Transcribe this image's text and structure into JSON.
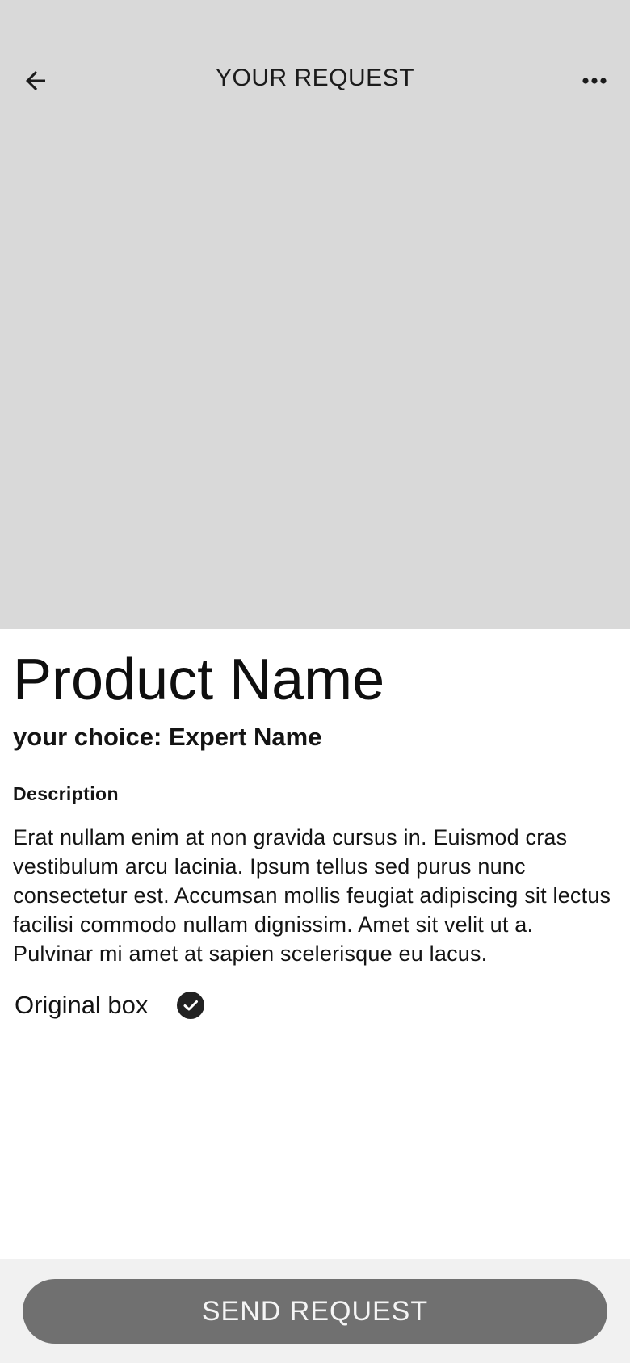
{
  "header": {
    "title": "YOUR REQUEST",
    "back_icon": "arrow-left-icon",
    "more_icon": "more-horizontal-icon"
  },
  "product": {
    "name": "Product Name",
    "choice_prefix": "your choice: ",
    "expert_name": "Expert Name",
    "description_label": "Description",
    "description": "Erat nullam enim at non gravida cursus in. Euismod cras vestibulum arcu lacinia. Ipsum tellus sed purus nunc consectetur est. Accumsan mollis feugiat adipiscing sit lectus facilisi commodo nullam dignissim. Amet sit velit ut a. Pulvinar mi amet at sapien scelerisque eu lacus.",
    "original_box_label": "Original box",
    "original_box_checked": true
  },
  "actions": {
    "send_label": "SEND REQUEST"
  },
  "colors": {
    "hero_background": "#d9d9d9",
    "button_background": "#707070",
    "bottom_bar_background": "#f1f1f1",
    "check_fill": "#222222"
  }
}
